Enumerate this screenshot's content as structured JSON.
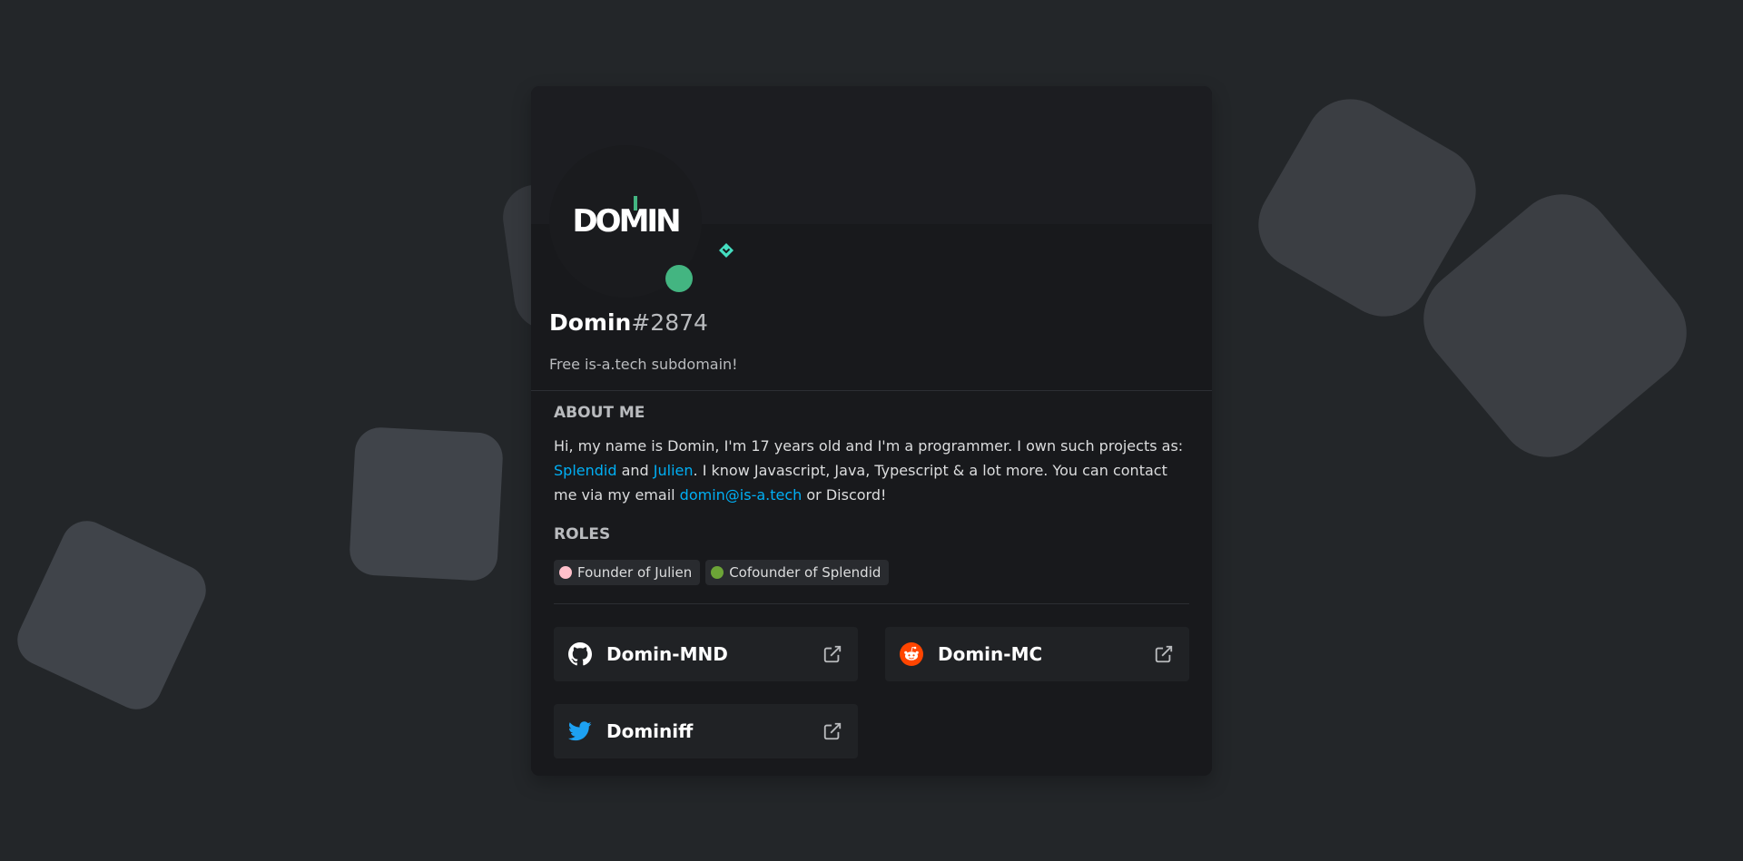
{
  "profile": {
    "avatar_text": "DOMIN",
    "username": "Domin",
    "discriminator": "#2874",
    "custom_status": "Free is-a.tech subdomain!",
    "status_color": "#43b581",
    "badge_icon": "hypesquad-diamond-icon"
  },
  "about": {
    "title": "ABOUT ME",
    "text_before": "Hi, my name is Domin, I'm 17 years old and I'm a programmer. I own such projects as: ",
    "link1": "Splendid",
    "text_and": " and ",
    "link2": "Julien",
    "text_middle": ". I know Javascript, Java, Typescript & a lot more. You can contact me via my email ",
    "email": "domin@is-a.tech",
    "text_end": " or Discord!"
  },
  "roles": {
    "title": "ROLES",
    "items": [
      {
        "label": "Founder of Julien",
        "color": "#ffc0cb"
      },
      {
        "label": "Cofounder of Splendid",
        "color": "#6ca437"
      }
    ]
  },
  "connections": [
    {
      "service": "github",
      "icon": "github-icon",
      "name": "Domin-MND"
    },
    {
      "service": "reddit",
      "icon": "reddit-icon",
      "name": "Domin-MC"
    },
    {
      "service": "twitter",
      "icon": "twitter-icon",
      "name": "Dominiff"
    }
  ],
  "colors": {
    "link": "#00aff4",
    "background": "#232629",
    "card": "#18191c"
  }
}
